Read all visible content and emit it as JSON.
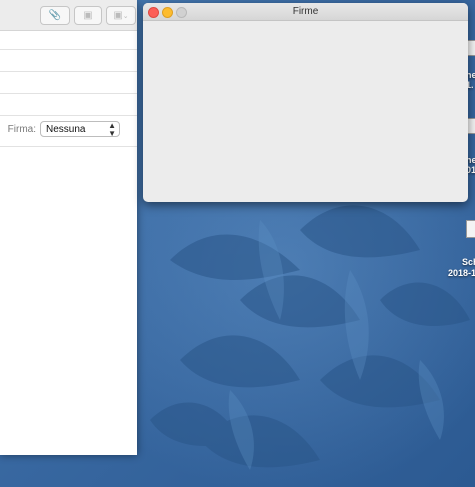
{
  "compose_window": {
    "signature": {
      "label": "Firma:",
      "value": "Nessuna"
    }
  },
  "firme_window": {
    "title": "Firme"
  },
  "desktop": {
    "items": [
      {
        "label": "he"
      },
      {
        "label": "1."
      },
      {
        "label": "he"
      },
      {
        "label": "01"
      },
      {
        "label": "Sch"
      },
      {
        "label": "2018-1"
      }
    ]
  },
  "colors": {
    "wallpaper": "#3a6aa3",
    "close": "#fc5f57",
    "minimize": "#fdbc2e"
  }
}
